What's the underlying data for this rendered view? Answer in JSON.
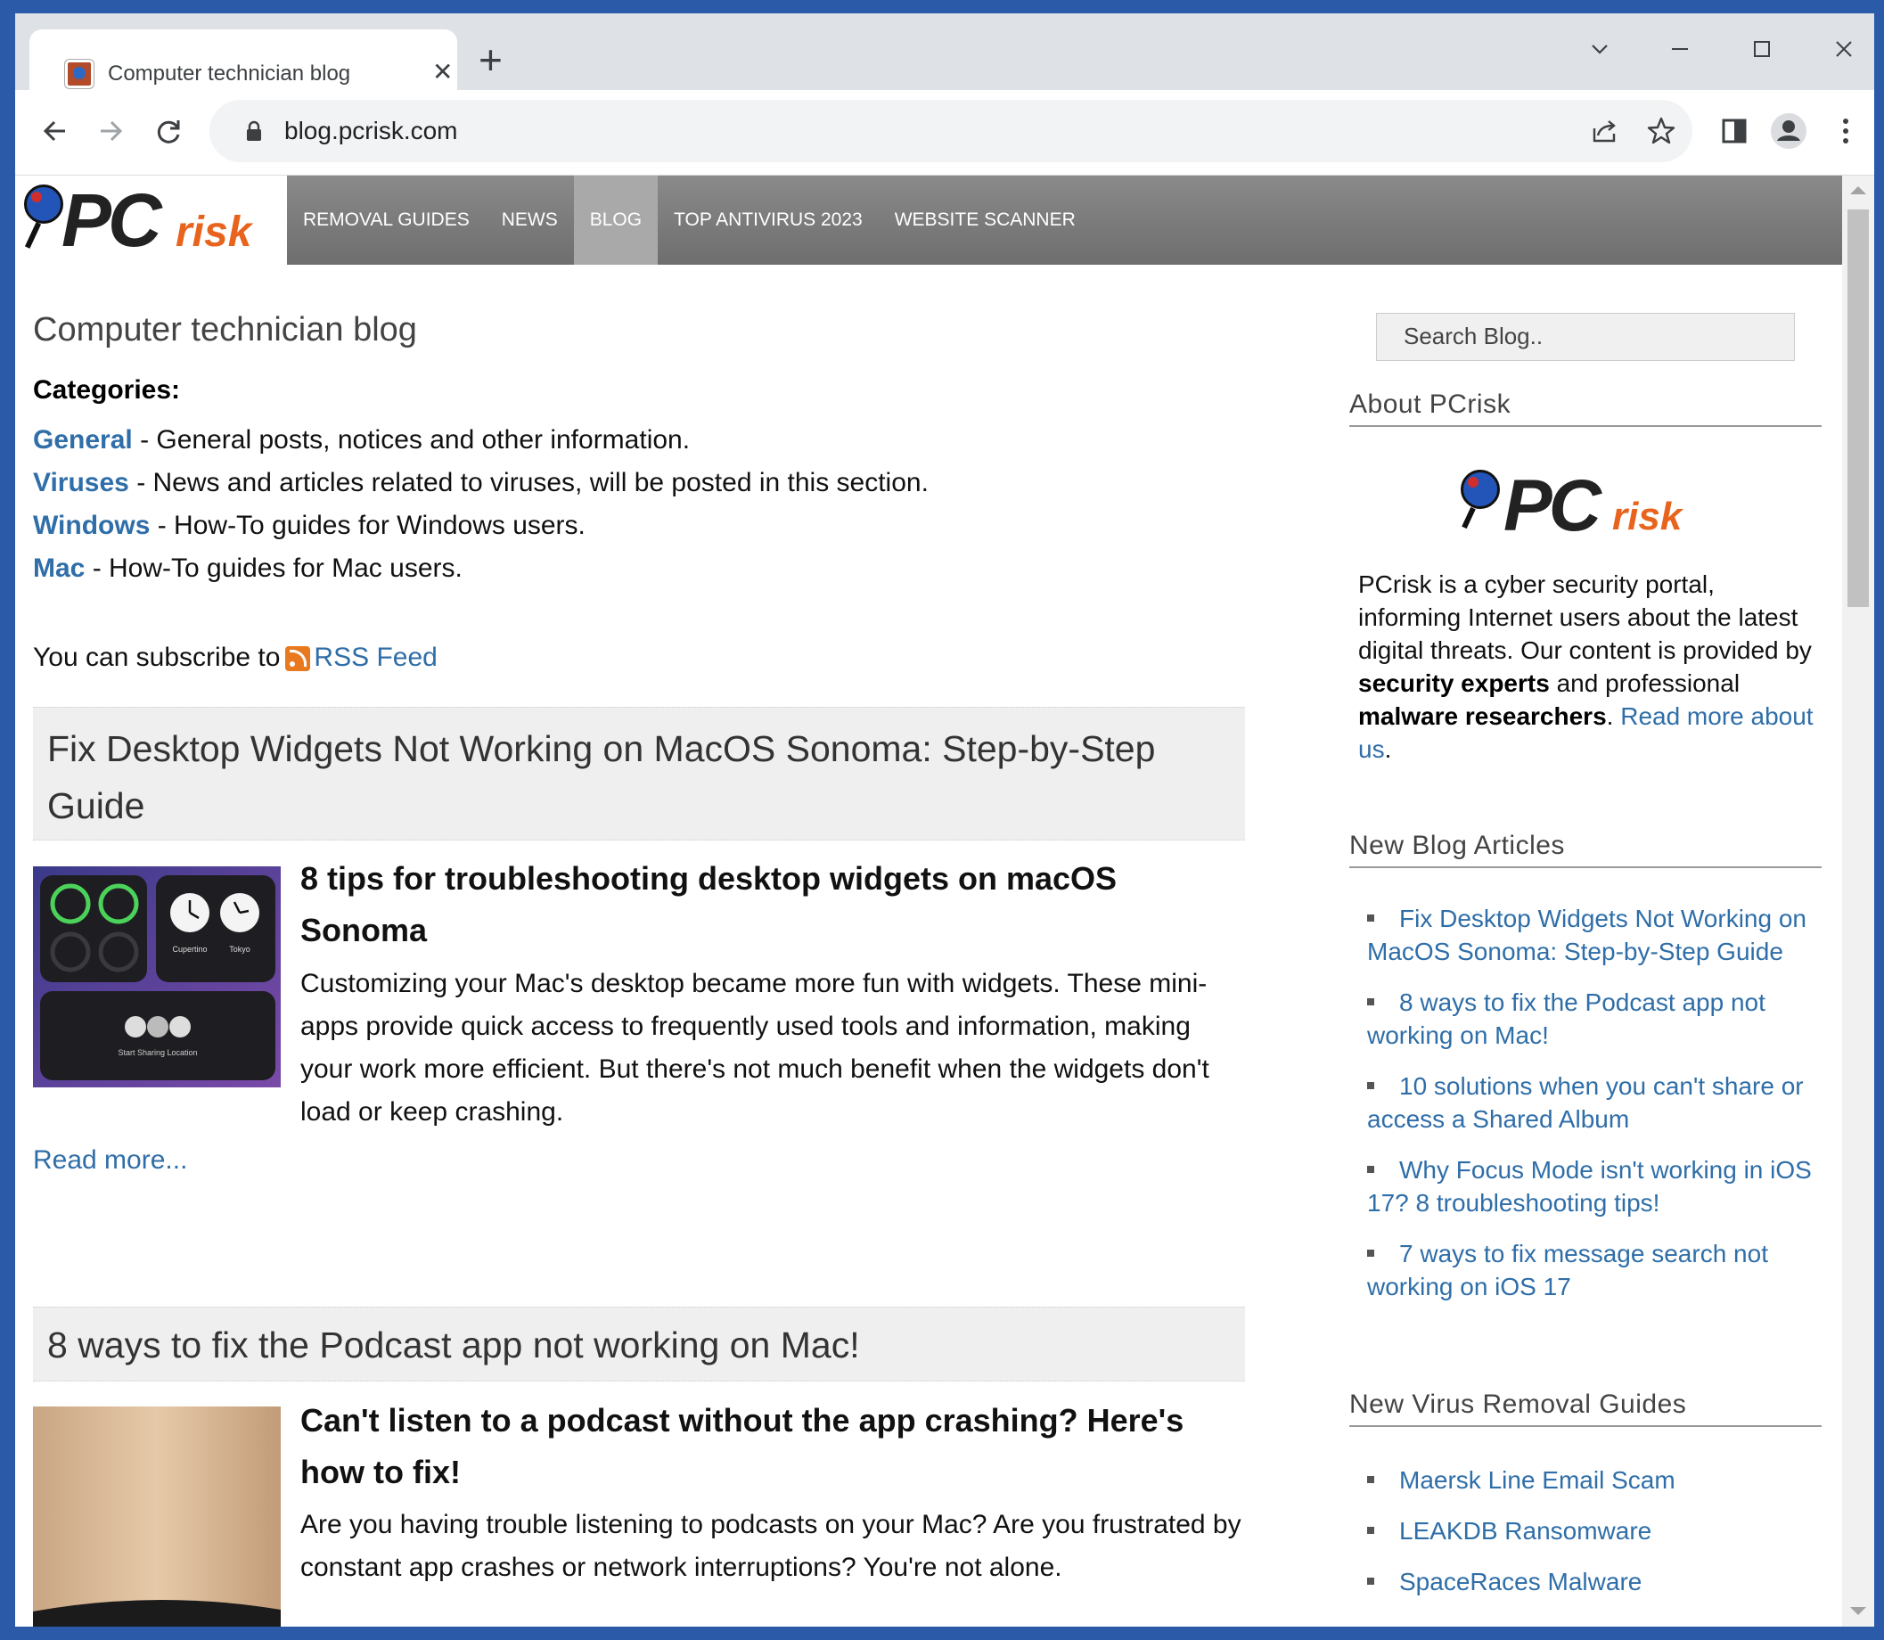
{
  "browser": {
    "tab_title": "Computer technician blog",
    "url": "blog.pcrisk.com"
  },
  "site": {
    "logo_pc": "PC",
    "logo_risk": "risk",
    "nav": [
      "REMOVAL GUIDES",
      "NEWS",
      "BLOG",
      "TOP ANTIVIRUS 2023",
      "WEBSITE SCANNER"
    ],
    "active_nav": "BLOG"
  },
  "main": {
    "title": "Computer technician blog",
    "categories_heading": "Categories:",
    "categories": [
      {
        "name": "General",
        "desc": " - General posts, notices and other information."
      },
      {
        "name": "Viruses",
        "desc": " - News and articles related to viruses, will be posted in this section."
      },
      {
        "name": "Windows",
        "desc": " - How-To guides for Windows users."
      },
      {
        "name": "Mac",
        "desc": " - How-To guides for Mac users."
      }
    ],
    "subscribe_text": "You can subscribe to",
    "rss_label": "RSS Feed",
    "posts": [
      {
        "title": "Fix Desktop Widgets Not Working on MacOS Sonoma: Step-by-Step Guide",
        "subtitle": "8 tips for troubleshooting desktop widgets on macOS Sonoma",
        "body": "Customizing your Mac's desktop became more fun with widgets. These mini-apps provide quick access to frequently used tools and information, making your work more efficient. But there's not much benefit when the widgets don't load or keep crashing.",
        "thumb_labels": [
          "Cupertino",
          "Tokyo",
          "Start Sharing Location"
        ],
        "read_more": "Read more..."
      },
      {
        "title": "8 ways to fix the Podcast app not working on Mac!",
        "subtitle": "Can't listen to a podcast without the app crashing? Here's how to fix!",
        "body": "Are you having trouble listening to podcasts on your Mac? Are you frustrated by constant app crashes or network interruptions? You're not alone."
      }
    ]
  },
  "sidebar": {
    "search_placeholder": "Search Blog..",
    "about_heading": "About PCrisk",
    "about_text_1": "PCrisk is a cyber security portal, informing Internet users about the latest digital threats. Our content is provided by ",
    "about_bold_1": "security experts",
    "about_text_2": " and professional ",
    "about_bold_2": "malware researchers",
    "about_text_3": ". ",
    "about_link": "Read more about us",
    "about_text_4": ".",
    "new_articles_heading": "New Blog Articles",
    "new_articles": [
      "Fix Desktop Widgets Not Working on MacOS Sonoma: Step-by-Step Guide",
      "8 ways to fix the Podcast app not working on Mac!",
      "10 solutions when you can't share or access a Shared Album",
      "Why Focus Mode isn't working in iOS 17? 8 troubleshooting tips!",
      "7 ways to fix message search not working on iOS 17"
    ],
    "virus_guides_heading": "New Virus Removal Guides",
    "virus_guides": [
      "Maersk Line Email Scam",
      "LEAKDB Ransomware",
      "SpaceRaces Malware"
    ]
  },
  "colors": {
    "link": "#2f6ea8",
    "header_gray": "#7a7a7a",
    "logo_orange": "#e8641e",
    "frame_blue": "#2a5aa8"
  }
}
